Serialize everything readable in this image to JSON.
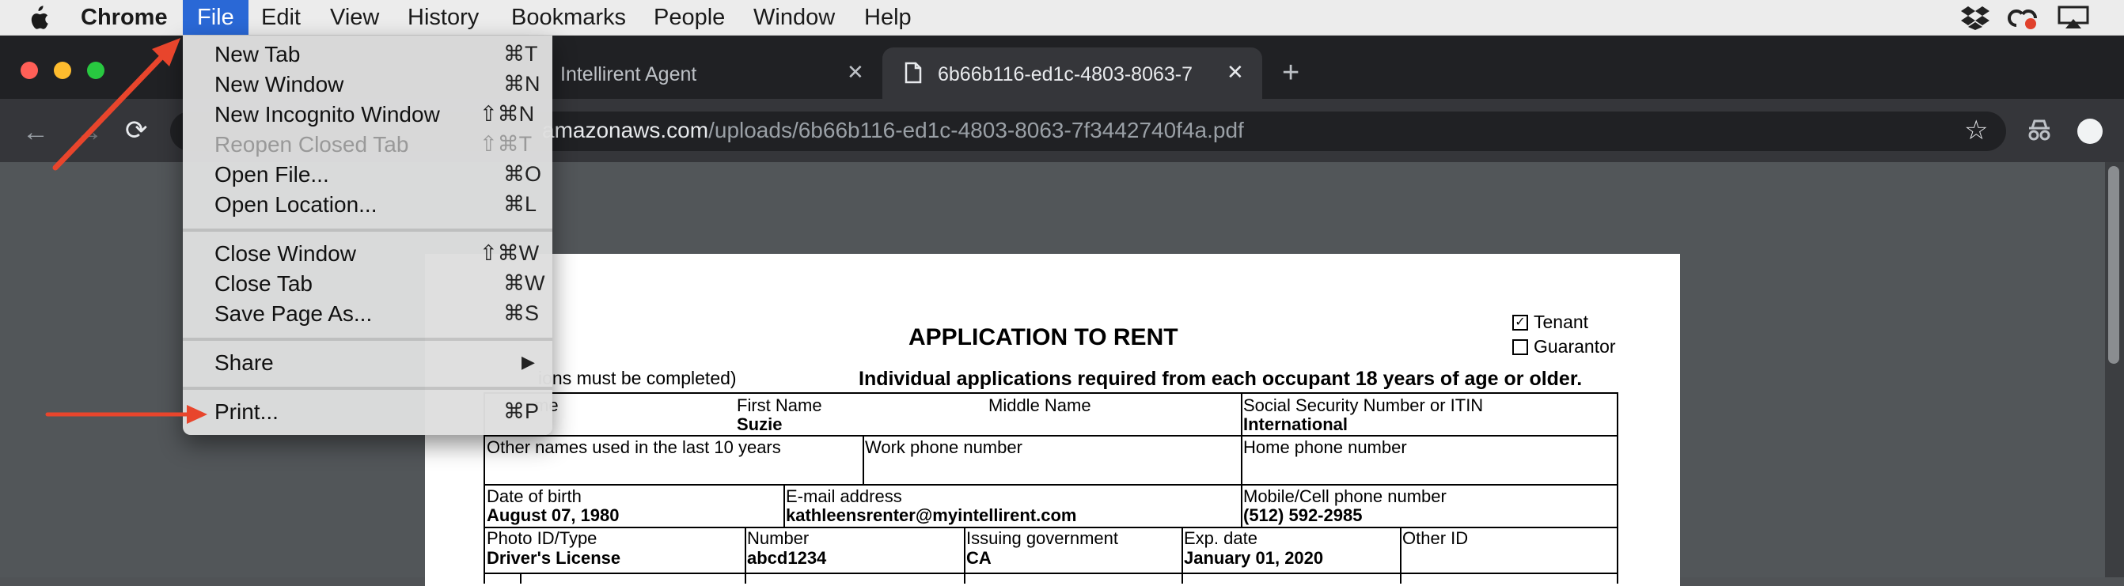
{
  "menubar": {
    "app": "Chrome",
    "items": [
      "File",
      "Edit",
      "View",
      "History",
      "Bookmarks",
      "People",
      "Window",
      "Help"
    ]
  },
  "tabs": [
    {
      "title": "Intellirent Agent"
    },
    {
      "title": "6b66b116-ed1c-4803-8063-7"
    }
  ],
  "address": {
    "host": "amazonaws.com",
    "path": "/uploads/6b66b116-ed1c-4803-8063-7f3442740f4a.pdf"
  },
  "file_menu": [
    {
      "label": "New Tab",
      "shortcut": "⌘T",
      "enabled": true
    },
    {
      "label": "New Window",
      "shortcut": "⌘N",
      "enabled": true
    },
    {
      "label": "New Incognito Window",
      "shortcut": "⇧⌘N",
      "enabled": true
    },
    {
      "label": "Reopen Closed Tab",
      "shortcut": "⇧⌘T",
      "enabled": false
    },
    {
      "label": "Open File...",
      "shortcut": "⌘O",
      "enabled": true
    },
    {
      "label": "Open Location...",
      "shortcut": "⌘L",
      "enabled": true
    },
    {
      "label": "Close Window",
      "shortcut": "⇧⌘W",
      "enabled": true
    },
    {
      "label": "Close Tab",
      "shortcut": "⌘W",
      "enabled": true
    },
    {
      "label": "Save Page As...",
      "shortcut": "⌘S",
      "enabled": true
    },
    {
      "label": "Share",
      "shortcut": "▶",
      "enabled": true
    },
    {
      "label": "Print...",
      "shortcut": "⌘P",
      "enabled": true
    }
  ],
  "document": {
    "title": "APPLICATION TO RENT",
    "checkboxes": [
      {
        "label": "Tenant",
        "checked": true
      },
      {
        "label": "Guarantor",
        "checked": false
      }
    ],
    "left_note": "ions must be completed)",
    "subtitle": "Individual applications required from each occupant 18 years of age or older.",
    "fields": {
      "last_name_label": "me",
      "first_name_label": "First Name",
      "first_name_value": "Suzie",
      "middle_name_label": "Middle Name",
      "ssn_label": "Social Security Number or ITIN",
      "ssn_value": "International",
      "other_names_label": "Other names used in the last 10 years",
      "work_phone_label": "Work phone number",
      "home_phone_label": "Home phone number",
      "dob_label": "Date of birth",
      "dob_value": "August 07, 1980",
      "email_label": "E-mail address",
      "email_value": "kathleensrenter@myintellirent.com",
      "mobile_label": "Mobile/Cell phone number",
      "mobile_value": "(512) 592-2985",
      "photo_id_label": "Photo ID/Type",
      "photo_id_value": "Driver's License",
      "number_label": "Number",
      "number_value": "abcd1234",
      "issuing_label": "Issuing government",
      "issuing_value": "CA",
      "exp_label": "Exp. date",
      "exp_value": "January 01, 2020",
      "other_id_label": "Other ID"
    }
  },
  "colors": {
    "menubar_active": "#2a68d6",
    "annotation_arrow": "#e8452c",
    "chrome_dark": "#202124"
  }
}
